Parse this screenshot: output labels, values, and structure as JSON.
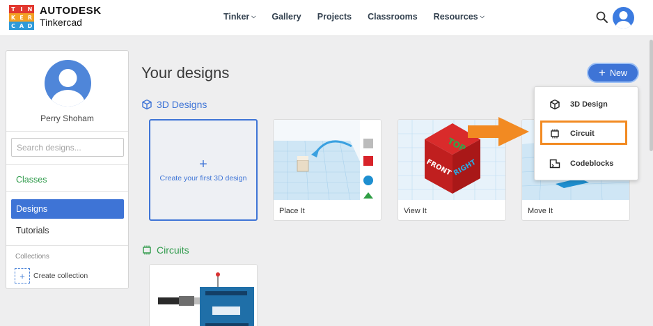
{
  "header": {
    "logo_letters": [
      "T",
      "I",
      "N",
      "K",
      "E",
      "R",
      "C",
      "A",
      "D"
    ],
    "logo_colors": [
      "#e2382f",
      "#e2382f",
      "#e2382f",
      "#f3a023",
      "#f3a023",
      "#f3a023",
      "#2e9ad9",
      "#2e9ad9",
      "#2e9ad9"
    ],
    "brand_top": "AUTODESK",
    "brand_bottom": "Tinkercad",
    "nav": [
      {
        "label": "Tinker",
        "has_dropdown": true
      },
      {
        "label": "Gallery",
        "has_dropdown": false
      },
      {
        "label": "Projects",
        "has_dropdown": false
      },
      {
        "label": "Classrooms",
        "has_dropdown": false
      },
      {
        "label": "Resources",
        "has_dropdown": true
      }
    ],
    "search_icon": "search-icon",
    "avatar_icon": "user-avatar-icon"
  },
  "sidebar": {
    "username": "Perry Shoham",
    "search_placeholder": "Search designs...",
    "classes_label": "Classes",
    "designs_label": "Designs",
    "tutorials_label": "Tutorials",
    "collections_heading": "Collections",
    "create_collection_label": "Create collection"
  },
  "main": {
    "title": "Your designs",
    "new_button_label": "New",
    "section_3d": "3D Designs",
    "section_circuits": "Circuits",
    "create_card_label": "Create your first 3D design",
    "cards": [
      {
        "label": "Place It"
      },
      {
        "label": "View It",
        "cube_faces": [
          "TOP",
          "FRONT",
          "RIGHT"
        ]
      },
      {
        "label": "Move It"
      }
    ]
  },
  "new_menu": {
    "items": [
      {
        "label": "3D Design",
        "icon": "cube-icon"
      },
      {
        "label": "Circuit",
        "icon": "circuit-chip-icon",
        "highlighted": true
      },
      {
        "label": "Codeblocks",
        "icon": "codeblocks-icon"
      }
    ],
    "highlight_color": "#f28a22"
  },
  "colors": {
    "accent_blue": "#3e74d6",
    "circuits_green": "#2e9a4a",
    "callout_orange": "#f28a22"
  }
}
